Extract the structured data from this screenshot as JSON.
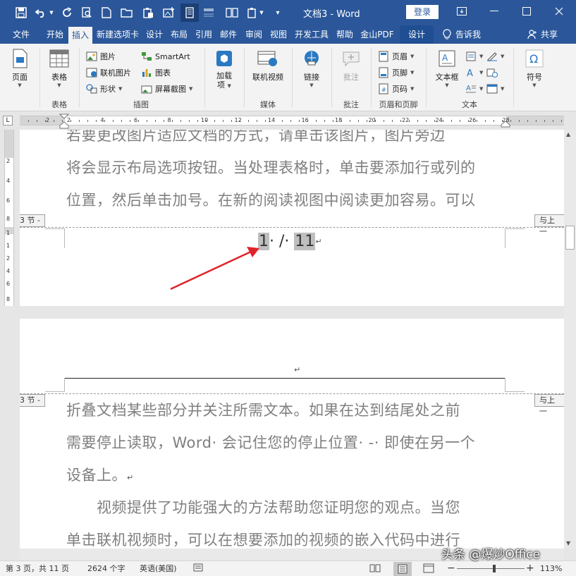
{
  "titlebar": {
    "doc_title": "文档3  -  Word",
    "login": "登录"
  },
  "tabs": {
    "file": "文件",
    "home": "开始",
    "insert": "插入",
    "new_tab": "新建选项卡",
    "design": "设计",
    "layout": "布局",
    "references": "引用",
    "mailings": "邮件",
    "review": "审阅",
    "view": "视图",
    "developer": "开发工具",
    "help": "帮助",
    "wps_pdf": "金山PDF",
    "ctx_design": "设计",
    "tell_me": "告诉我",
    "share": "共享"
  },
  "ribbon": {
    "page": "页面",
    "table_btn": "表格",
    "table_group": "表格",
    "picture": "图片",
    "online_picture": "联机图片",
    "shapes": "形状",
    "smartart": "SmartArt",
    "chart": "图表",
    "screenshot": "屏幕截图",
    "illustrations_group": "插图",
    "addins": "加载\n项",
    "online_video": "联机视频",
    "media_group": "媒体",
    "link": "链接",
    "comment": "批注",
    "comment_group": "批注",
    "header": "页眉",
    "footer": "页脚",
    "page_number": "页码",
    "header_footer_group": "页眉和页脚",
    "textbox": "文本框",
    "text_group": "文本",
    "symbol": "符号"
  },
  "ruler_numbers": [
    "2",
    "2",
    "4",
    "6",
    "8",
    "10",
    "12",
    "14",
    "16",
    "18",
    "20",
    "22",
    "24",
    "26",
    "28"
  ],
  "vruler_numbers": [
    "2",
    "4",
    "6",
    "8",
    "1",
    "1",
    "2",
    "4",
    "6",
    "8"
  ],
  "document": {
    "page_a_lines": [
      "若要更改图片适应文档的方式，请单击该图片，图片旁边",
      "将会显示布局选项按钮。当处理表格时，单击要添加行或列的",
      "位置，然后单击加号。在新的阅读视图中阅读更加容易。可以"
    ],
    "section_label": "3 节 -",
    "link_prev": "与上一",
    "page_field_current": "1",
    "page_field_sep": "· /· ",
    "page_field_total": "11",
    "para_mark": "↵",
    "page_b_lines": [
      "折叠文档某些部分并关注所需文本。如果在达到结尾处之前",
      "需要停止读取，Word· 会记住您的停止位置· -· 即使在另一个",
      "设备上。",
      "　　视频提供了功能强大的方法帮助您证明您的观点。当您",
      "单击联机视频时，可以在想要添加的视频的嵌入代码中进行"
    ]
  },
  "statusbar": {
    "page_info": "第 3 页，共 11 页",
    "word_count": "2624 个字",
    "language": "英语(美国)",
    "zoom": "113%"
  },
  "watermark": "头条 @爆炒Office",
  "colors": {
    "accent": "#2b579a",
    "arrow": "#e0232a",
    "field_shade": "#bfbfbf"
  }
}
